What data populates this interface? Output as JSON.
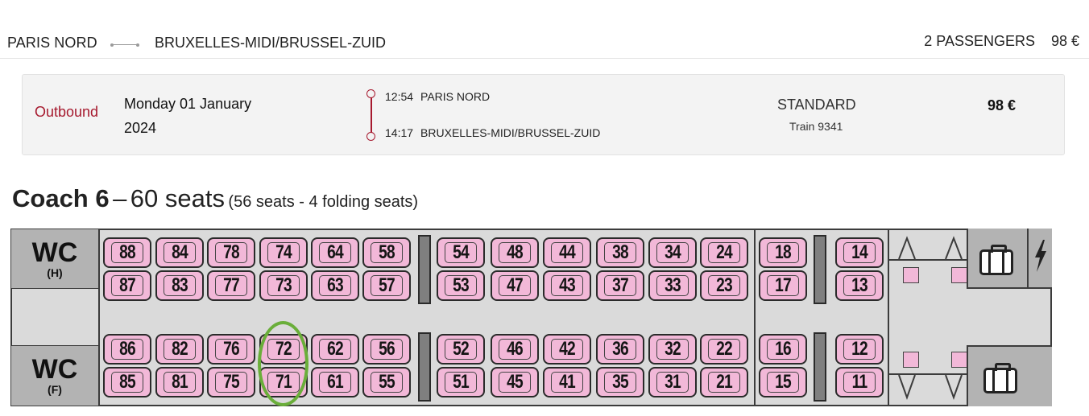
{
  "header": {
    "origin": "PARIS NORD",
    "destination": "BRUXELLES-MIDI/BRUSSEL-ZUID",
    "passengers": "2 PASSENGERS",
    "total": "98 €"
  },
  "journey": {
    "direction": "Outbound",
    "date": "Monday 01 January 2024",
    "departure_time": "12:54",
    "departure_station": "PARIS NORD",
    "arrival_time": "14:17",
    "arrival_station": "BRUXELLES-MIDI/BRUSSEL-ZUID",
    "class": "STANDARD",
    "train": "Train 9341",
    "price": "98 €"
  },
  "coach": {
    "name": "Coach 6",
    "separator": "–",
    "seats": "60 seats",
    "detail": "(56 seats - 4 folding seats)"
  },
  "seat_map": {
    "wc_top_label": "WC",
    "wc_top_sub": "(H)",
    "wc_bottom_label": "WC",
    "wc_bottom_sub": "(F)",
    "rows": {
      "row1": [
        "88",
        "84",
        "78",
        "74",
        "64",
        "58",
        "54",
        "48",
        "44",
        "38",
        "34",
        "24",
        "18",
        "14"
      ],
      "row2": [
        "87",
        "83",
        "77",
        "73",
        "63",
        "57",
        "53",
        "47",
        "43",
        "37",
        "33",
        "23",
        "17",
        "13"
      ],
      "row3": [
        "86",
        "82",
        "76",
        "72",
        "62",
        "56",
        "52",
        "46",
        "42",
        "36",
        "32",
        "22",
        "16",
        "12"
      ],
      "row4": [
        "85",
        "81",
        "75",
        "71",
        "61",
        "55",
        "51",
        "45",
        "41",
        "35",
        "31",
        "21",
        "15",
        "11"
      ]
    },
    "highlighted_seat_color": "#6aae3a",
    "seat_color": "#f2b8d8",
    "icons": [
      "luggage-icon",
      "electric-icon"
    ]
  },
  "colors": {
    "accent": "#a6192e"
  }
}
